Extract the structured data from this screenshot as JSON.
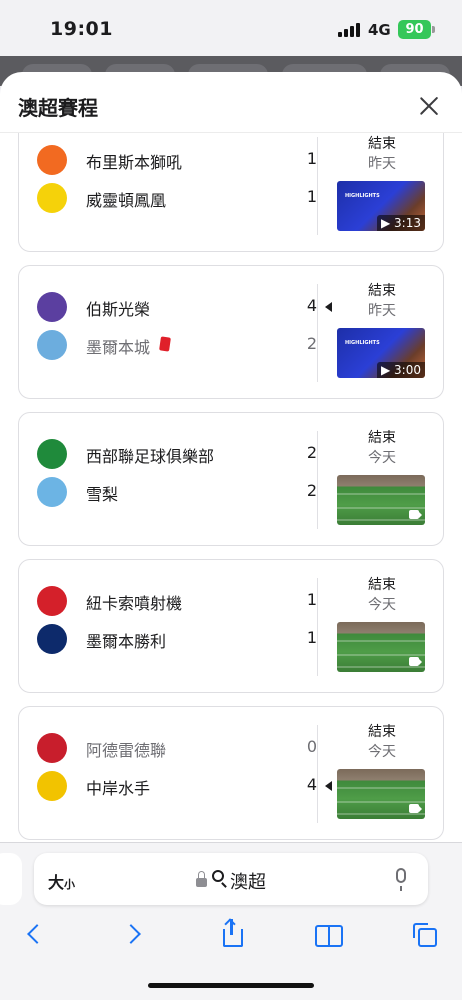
{
  "status_bar": {
    "time": "19:01",
    "network": "4G",
    "battery": "90"
  },
  "sheet": {
    "title": "澳超賽程"
  },
  "matches": [
    {
      "home": {
        "name": "布里斯本獅吼",
        "score": "1",
        "logo_color": "#f26a21",
        "winner": false,
        "red_card": false
      },
      "away": {
        "name": "威靈頓鳳凰",
        "score": "1",
        "logo_color": "#f5d20a",
        "winner": false,
        "red_card": false
      },
      "status": "結束",
      "day": "昨天",
      "media": "highlight",
      "duration": "3:13"
    },
    {
      "home": {
        "name": "伯斯光榮",
        "score": "4",
        "logo_color": "#5b3fa0",
        "winner": true,
        "red_card": false
      },
      "away": {
        "name": "墨爾本城",
        "score": "2",
        "logo_color": "#6cadde",
        "winner": false,
        "red_card": true
      },
      "status": "結束",
      "day": "昨天",
      "media": "highlight",
      "duration": "3:00"
    },
    {
      "home": {
        "name": "西部聯足球俱樂部",
        "score": "2",
        "logo_color": "#1f8a3b",
        "winner": false,
        "red_card": false
      },
      "away": {
        "name": "雪梨",
        "score": "2",
        "logo_color": "#6cb4e4",
        "winner": false,
        "red_card": false
      },
      "status": "結束",
      "day": "今天",
      "media": "pitch",
      "duration": ""
    },
    {
      "home": {
        "name": "紐卡索噴射機",
        "score": "1",
        "logo_color": "#d4202a",
        "winner": false,
        "red_card": false
      },
      "away": {
        "name": "墨爾本勝利",
        "score": "1",
        "logo_color": "#0d2a6b",
        "winner": false,
        "red_card": false
      },
      "status": "結束",
      "day": "今天",
      "media": "pitch",
      "duration": ""
    },
    {
      "home": {
        "name": "阿德雷德聯",
        "score": "0",
        "logo_color": "#c81e2c",
        "winner": false,
        "red_card": false
      },
      "away": {
        "name": "中岸水手",
        "score": "4",
        "logo_color": "#f2c300",
        "winner": true,
        "red_card": false
      },
      "status": "結束",
      "day": "今天",
      "media": "pitch",
      "duration": ""
    }
  ],
  "highlight_text": "HIGHLIGHTS",
  "toolbar": {
    "text_size_big": "大",
    "text_size_small": "小",
    "query": "澳超"
  },
  "colors": {
    "accent": "#1a73f5",
    "battery": "#35c759",
    "red_card": "#e0202a"
  }
}
